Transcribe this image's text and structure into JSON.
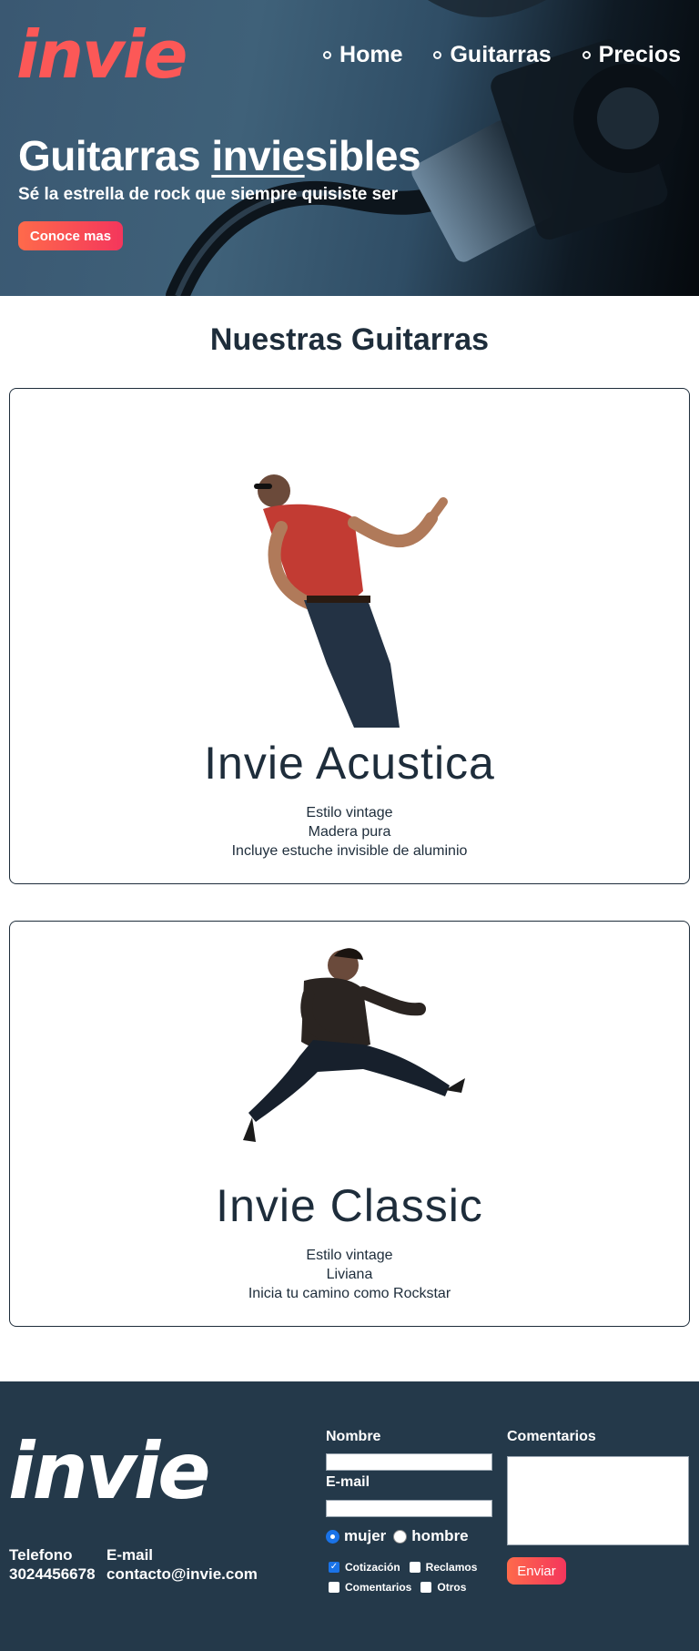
{
  "header": {
    "logo": "invie",
    "nav": [
      {
        "label": "Home"
      },
      {
        "label": "Guitarras"
      },
      {
        "label": "Precios"
      }
    ],
    "hero_title_pre": "Guitarras ",
    "hero_title_underlined": "invie",
    "hero_title_post": "sibles",
    "hero_subtitle": "Sé la estrella de rock que siempre quisiste ser",
    "hero_button": "Conoce mas"
  },
  "products": {
    "title": "Nuestras Guitarras",
    "items": [
      {
        "name": "Invie Acustica",
        "features": [
          "Estilo vintage",
          "Madera pura",
          "Incluye estuche invisible de aluminio"
        ]
      },
      {
        "name": "Invie Classic",
        "features": [
          "Estilo vintage",
          "Liviana",
          "Inicia tu camino como Rockstar"
        ]
      }
    ]
  },
  "footer": {
    "logo": "invie",
    "phone_label": "Telefono",
    "phone": "3024456678",
    "email_label": "E-mail",
    "email": "contacto@invie.com",
    "form": {
      "name_label": "Nombre",
      "email_label": "E-mail",
      "comments_label": "Comentarios",
      "name_value": "",
      "email_value": "",
      "comments_value": "",
      "radios": [
        {
          "label": "mujer",
          "checked": true
        },
        {
          "label": "hombre",
          "checked": false
        }
      ],
      "checkboxes": [
        {
          "label": "Cotización",
          "checked": true
        },
        {
          "label": "Reclamos",
          "checked": false
        },
        {
          "label": "Comentarios",
          "checked": false
        },
        {
          "label": "Otros",
          "checked": false
        }
      ],
      "submit": "Enviar"
    }
  },
  "colors": {
    "brand": "#fc5857",
    "navy": "#1e2d3b",
    "footer_bg": "#24394a",
    "check_blue": "#1a73e8"
  }
}
